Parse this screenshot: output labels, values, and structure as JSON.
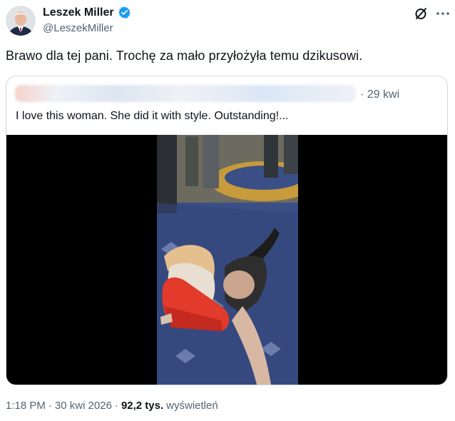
{
  "author": {
    "display_name": "Leszek Miller",
    "handle": "@LeszekMiller",
    "verified": true,
    "avatar_icon": "profile-photo"
  },
  "post": {
    "text": "Brawo dla tej pani. Trochę za mało przyłożyła temu dzikusowi."
  },
  "quote": {
    "time": "· 29 kwi",
    "text": "I love this woman. She did it with style. Outstanding!...",
    "media": {
      "type": "video",
      "icon": "video-thumbnail"
    }
  },
  "meta": {
    "time": "1:18 PM",
    "date": "30 kwi 2026",
    "separator": "·",
    "views_count": "92,2 tys.",
    "views_label": "wyświetleń"
  },
  "icons": {
    "grok": "grok-icon",
    "more": "more-icon",
    "verified": "verified-badge-icon"
  },
  "colors": {
    "verified_blue": "#1d9bf0",
    "secondary_text": "#536471",
    "border": "#cfd9de"
  }
}
